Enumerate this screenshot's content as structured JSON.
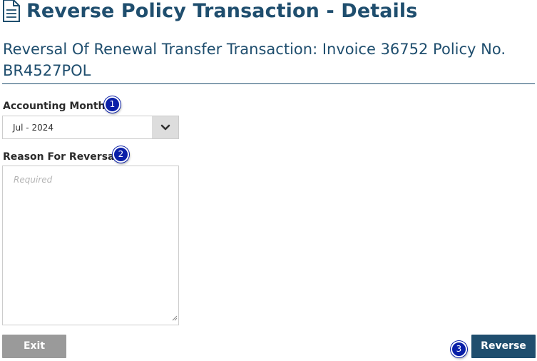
{
  "header": {
    "title": "Reverse Policy Transaction - Details",
    "icon": "document-icon",
    "subtitle": "Reversal Of Renewal Transfer Transaction: Invoice 36752  Policy No. BR4527POL"
  },
  "form": {
    "accounting_month": {
      "label": "Accounting Month",
      "selected_value": "Jul - 2024",
      "callout": "1"
    },
    "reason": {
      "label": "Reason For Reversal",
      "placeholder": "Required",
      "value": "",
      "callout": "2"
    }
  },
  "actions": {
    "exit_label": "Exit",
    "reverse_label": "Reverse",
    "reverse_callout": "3"
  },
  "colors": {
    "primary": "#1f4e6e",
    "exit_button": "#9a9a9a",
    "callout": "#0a1fa8"
  }
}
